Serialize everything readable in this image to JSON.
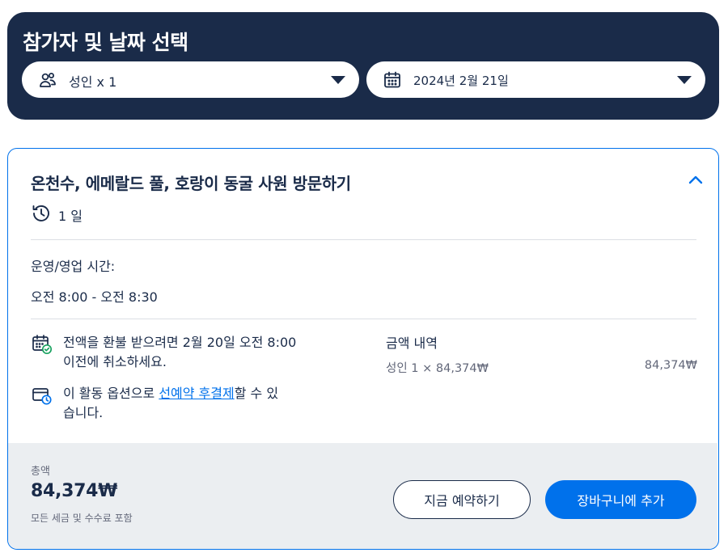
{
  "header": {
    "title": "참가자 및 날짜 선택",
    "participants": {
      "icon": "people-icon",
      "value": "성인 x 1"
    },
    "date": {
      "icon": "calendar-icon",
      "value": "2024년 2월 21일"
    }
  },
  "activity": {
    "title": "온천수, 에메랄드 풀, 호랑이 동굴 사원 방문하기",
    "duration": "1 일",
    "hours_label": "운영/영업 시간:",
    "hours_value": "오전 8:00 - 오전 8:30",
    "cancellation": {
      "line1": "전액을 환불 받으려면 2월 20일 오전 8:00",
      "line2": "이전에 취소하세요."
    },
    "reserve": {
      "prefix": "이 활동 옵션으로 ",
      "link": "선예약 후결제",
      "suffix": "할 수 있",
      "line2": "습니다."
    },
    "price_breakdown": {
      "heading": "금액 내역",
      "row_label": "성인 1 × 84,374₩",
      "row_amount": "84,374₩"
    }
  },
  "footer": {
    "total_label": "총액",
    "total_value": "84,374₩",
    "total_note": "모든 세금 및 수수료 포함",
    "book_now": "지금 예약하기",
    "add_to_cart": "장바구니에 추가"
  },
  "colors": {
    "navy": "#1a2b49",
    "accent": "#0071eb",
    "footer_bg": "#ebeef1",
    "muted_text": "#63687a",
    "check_green": "#1aa260"
  }
}
